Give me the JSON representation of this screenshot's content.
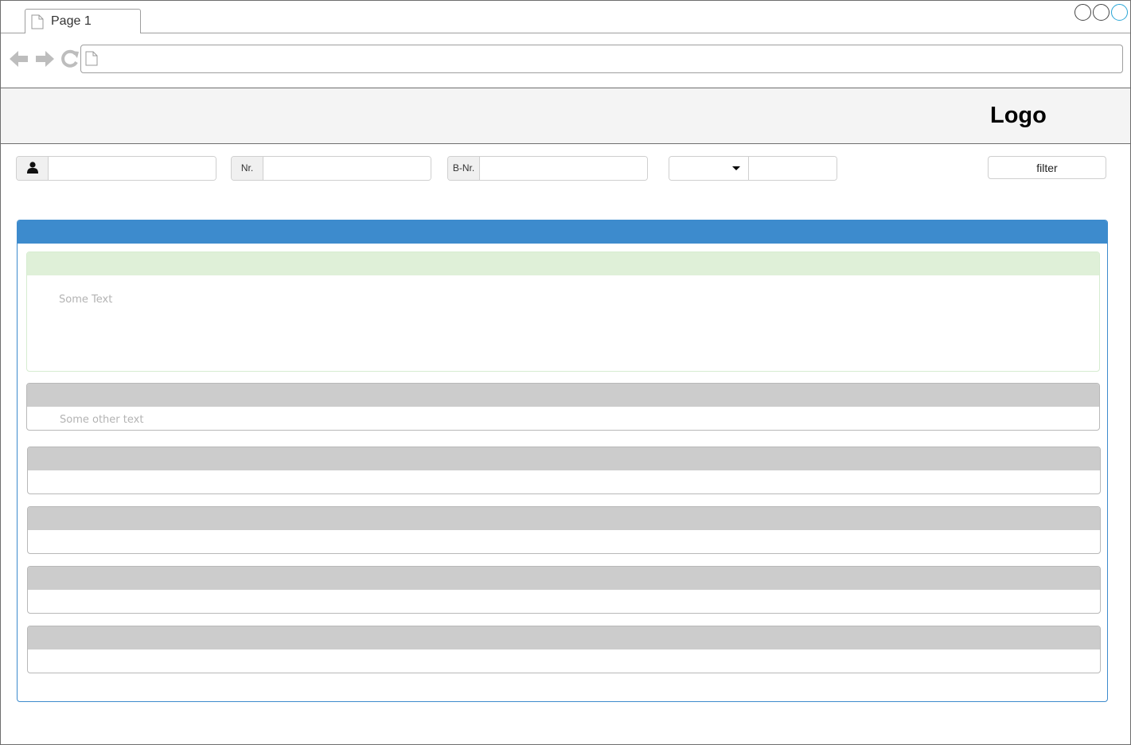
{
  "browser": {
    "tab_title": "Page 1",
    "url": ""
  },
  "header": {
    "logo": "Logo"
  },
  "filters": {
    "user_icon": "user-icon",
    "nr_label": "Nr.",
    "nr_value": "",
    "bnr_label": "B-Nr.",
    "bnr_value": "",
    "user_value": "",
    "select_value": "",
    "extra_value": "",
    "filter_label": "filter"
  },
  "panels": [
    {
      "style": "success",
      "body_text": "Some Text"
    },
    {
      "style": "default",
      "body_text": "Some other text"
    },
    {
      "style": "default",
      "body_text": ""
    },
    {
      "style": "default",
      "body_text": ""
    },
    {
      "style": "default",
      "body_text": ""
    },
    {
      "style": "default",
      "body_text": ""
    }
  ],
  "colors": {
    "primary": "#3d8bcd",
    "success_header": "#dff0d8",
    "default_header": "#cccccc",
    "header_bg": "#f4f4f4"
  }
}
